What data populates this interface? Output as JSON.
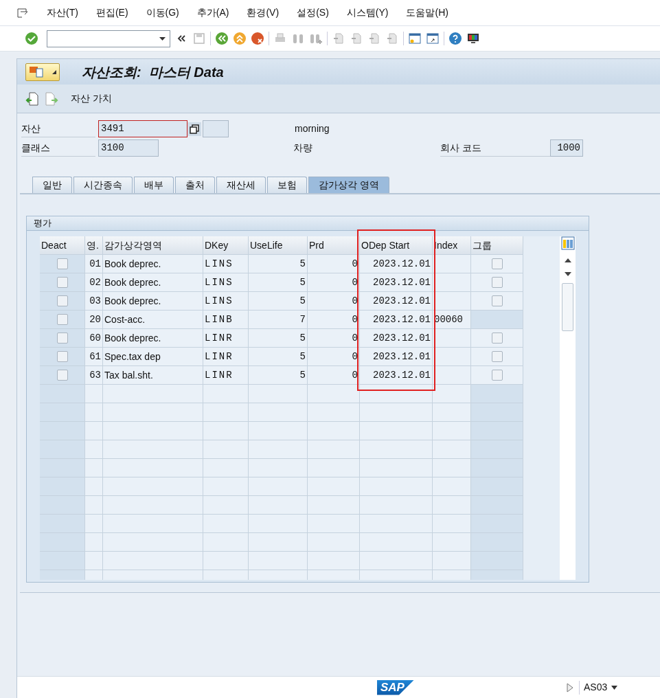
{
  "menu": [
    {
      "label": "자산(T)"
    },
    {
      "label": "편집(E)"
    },
    {
      "label": "이동(G)"
    },
    {
      "label": "추가(A)"
    },
    {
      "label": "환경(V)"
    },
    {
      "label": "설정(S)"
    },
    {
      "label": "시스템(Y)"
    },
    {
      "label": "도움말(H)"
    }
  ],
  "title": {
    "prefix": "자산조회:",
    "main": "마스터 Data"
  },
  "app_toolbar": {
    "label": "자산 가치"
  },
  "header": {
    "asset_label": "자산",
    "asset_value": "3491",
    "description": "morning",
    "class_label": "클래스",
    "class_value": "3100",
    "class_description": "차량",
    "company_label": "회사 코드",
    "company_value": "1000"
  },
  "tabs": [
    {
      "label": "일반",
      "selected": false
    },
    {
      "label": "시간종속",
      "selected": false
    },
    {
      "label": "배부",
      "selected": false
    },
    {
      "label": "출처",
      "selected": false
    },
    {
      "label": "재산세",
      "selected": false
    },
    {
      "label": "보험",
      "selected": false
    },
    {
      "label": "감가상각 영역",
      "selected": true
    }
  ],
  "group_title": "평가",
  "table": {
    "columns": [
      {
        "label": "Deact",
        "highlighted": false
      },
      {
        "label": "영.",
        "highlighted": false
      },
      {
        "label": "감가상각영역",
        "highlighted": false
      },
      {
        "label": "DKey",
        "highlighted": false
      },
      {
        "label": "UseLife",
        "highlighted": false
      },
      {
        "label": "Prd",
        "highlighted": false
      },
      {
        "label": "ODep Start",
        "highlighted": true
      },
      {
        "label": "Index",
        "highlighted": false
      },
      {
        "label": "그룹",
        "highlighted": false
      }
    ],
    "rows": [
      {
        "deact": false,
        "area": "01",
        "name": "Book deprec.",
        "dkey": "LINS",
        "uselife": "5",
        "prd": "0",
        "odep_start": "2023.12.01",
        "group": {
          "checked": false
        }
      },
      {
        "deact": false,
        "area": "02",
        "name": "Book deprec.",
        "dkey": "LINS",
        "uselife": "5",
        "prd": "0",
        "odep_start": "2023.12.01",
        "group": {
          "checked": false
        }
      },
      {
        "deact": false,
        "area": "03",
        "name": "Book deprec.",
        "dkey": "LINS",
        "uselife": "5",
        "prd": "0",
        "odep_start": "2023.12.01",
        "group": {
          "checked": false
        }
      },
      {
        "deact": false,
        "area": "20",
        "name": "Cost-acc.",
        "dkey": "LINB",
        "uselife": "7",
        "prd": "0",
        "odep_start": "2023.12.01",
        "index": "00060"
      },
      {
        "deact": false,
        "area": "60",
        "name": "Book deprec.",
        "dkey": "LINR",
        "uselife": "5",
        "prd": "0",
        "odep_start": "2023.12.01",
        "group": {
          "checked": false
        }
      },
      {
        "deact": false,
        "area": "61",
        "name": "Spec.tax dep",
        "dkey": "LINR",
        "uselife": "5",
        "prd": "0",
        "odep_start": "2023.12.01",
        "group": {
          "checked": false
        }
      },
      {
        "deact": false,
        "area": "63",
        "name": "Tax bal.sht.",
        "dkey": "LINR",
        "uselife": "5",
        "prd": "0",
        "odep_start": "2023.12.01",
        "group": {
          "checked": false
        }
      }
    ]
  },
  "status_bar": {
    "logo": "SAP",
    "transaction": "AS03"
  }
}
